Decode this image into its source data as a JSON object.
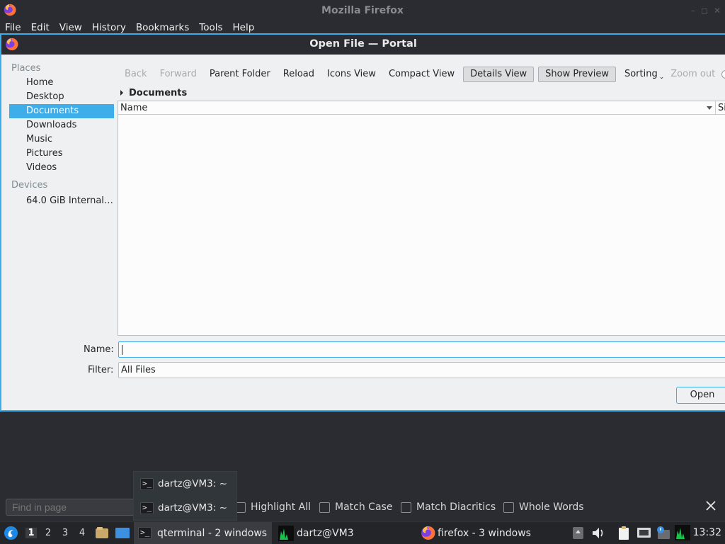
{
  "firefox": {
    "title": "Mozilla Firefox",
    "menu": [
      "File",
      "Edit",
      "View",
      "History",
      "Bookmarks",
      "Tools",
      "Help"
    ]
  },
  "dialog": {
    "title": "Open File — Portal",
    "places_header": "Places",
    "places": [
      "Home",
      "Desktop",
      "Documents",
      "Downloads",
      "Music",
      "Pictures",
      "Videos"
    ],
    "selected_place": "Documents",
    "devices_header": "Devices",
    "devices": [
      "64.0 GiB Internal ..."
    ],
    "toolbar": {
      "back": "Back",
      "forward": "Forward",
      "parent_folder": "Parent Folder",
      "reload": "Reload",
      "icons_view": "Icons View",
      "compact_view": "Compact View",
      "details_view": "Details View",
      "show_preview": "Show Preview",
      "sorting": "Sorting",
      "zoom_out": "Zoom out"
    },
    "breadcrumb": "Documents",
    "columns": {
      "name": "Name",
      "size": "Si"
    },
    "name_label": "Name:",
    "name_value": "",
    "filter_label": "Filter:",
    "filter_value": "All Files",
    "open_button": "Open"
  },
  "findbar": {
    "placeholder": "Find in page",
    "highlight_all": "Highlight All",
    "match_case": "Match Case",
    "match_diacritics": "Match Diacritics",
    "whole_words": "Whole Words"
  },
  "taskbar_popup": [
    "dartz@VM3: ~",
    "dartz@VM3: ~"
  ],
  "taskbar": {
    "workspaces": [
      "1",
      "2",
      "3",
      "4"
    ],
    "active_workspace": "1",
    "qterminal": "qterminal - 2 windows",
    "monitor": "dartz@VM3",
    "firefox": "firefox - 3 windows",
    "clock": "13:32"
  },
  "colors": {
    "accent": "#3daee9",
    "panel": "#2b2c31",
    "dialog_bg": "#eff0f1"
  }
}
